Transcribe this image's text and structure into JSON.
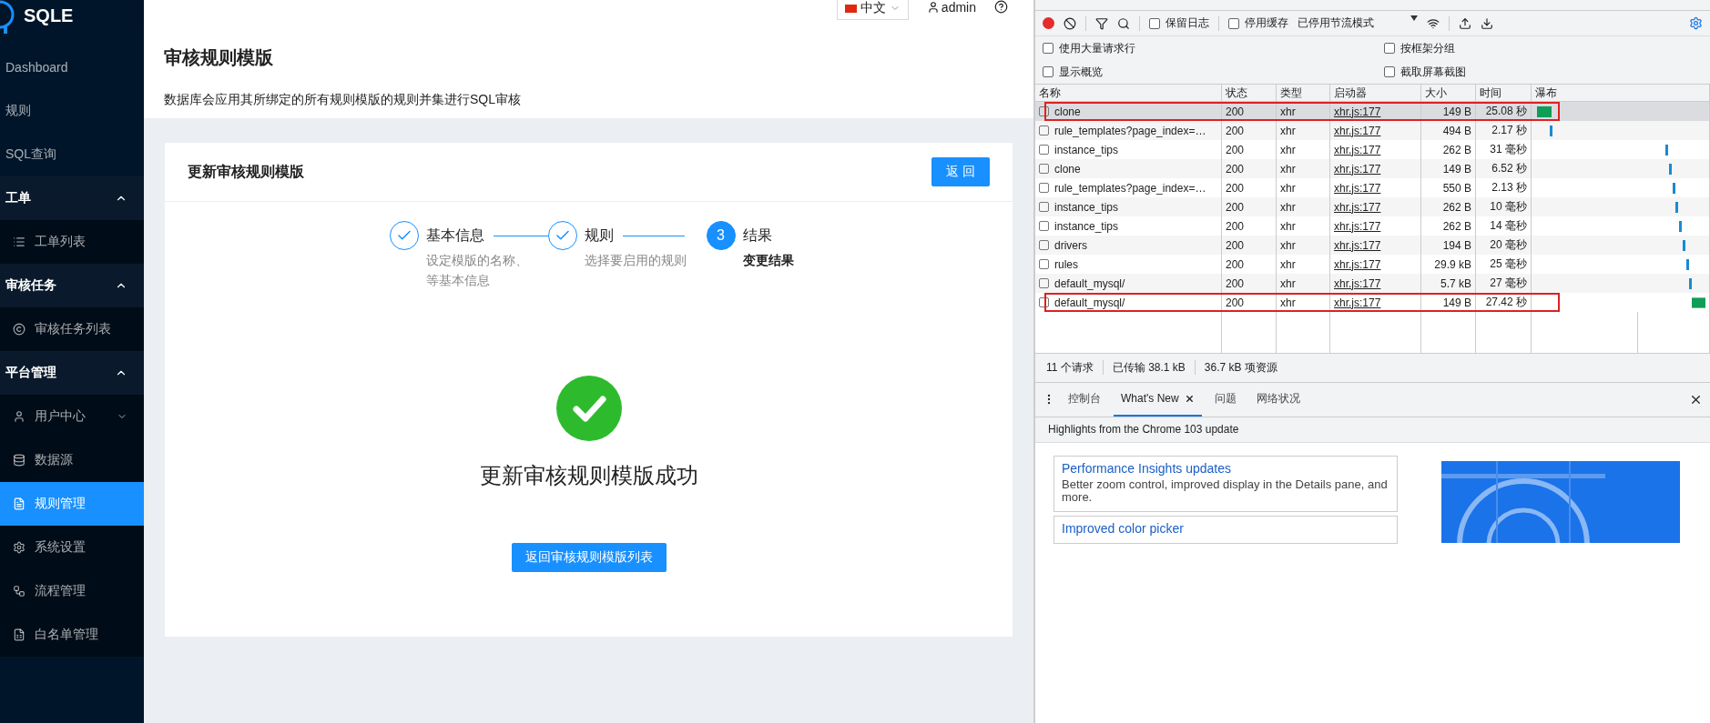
{
  "sidebar": {
    "logo": "SQLE",
    "items": [
      {
        "kind": "link",
        "label": "Dashboard",
        "selected": false
      },
      {
        "kind": "link",
        "label": "规则",
        "selected": false
      },
      {
        "kind": "link",
        "label": "SQL查询",
        "selected": false
      },
      {
        "kind": "group",
        "label": "工单",
        "expanded": true,
        "children": [
          {
            "kind": "link",
            "label": "工单列表",
            "selected": false
          }
        ]
      },
      {
        "kind": "group",
        "label": "审核任务",
        "expanded": true,
        "children": [
          {
            "kind": "link",
            "label": "审核任务列表",
            "selected": false
          }
        ]
      },
      {
        "kind": "group",
        "label": "平台管理",
        "expanded": true,
        "children": [
          {
            "kind": "submenu",
            "label": "用户中心",
            "expanded": false,
            "selected": false
          },
          {
            "kind": "link",
            "label": "数据源",
            "selected": false
          },
          {
            "kind": "link",
            "label": "规则管理",
            "selected": true
          },
          {
            "kind": "link",
            "label": "系统设置",
            "selected": false
          },
          {
            "kind": "link",
            "label": "流程管理",
            "selected": false
          },
          {
            "kind": "link",
            "label": "白名单管理",
            "selected": false
          }
        ]
      }
    ]
  },
  "topbar": {
    "language": "中文",
    "user": "admin"
  },
  "page": {
    "title": "审核规则模版",
    "description": "数据库会应用其所绑定的所有规则模版的规则并集进行SQL审核"
  },
  "card": {
    "title": "更新审核规则模版",
    "back_button": "返 回",
    "steps": [
      {
        "title": "基本信息",
        "description_lines": [
          "设定模版的名称、",
          "等基本信息"
        ],
        "finished": true
      },
      {
        "title": "规则",
        "description_lines": [
          "选择要启用的规则"
        ],
        "finished": true
      },
      {
        "title": "结果",
        "number": "3",
        "description_lines": [
          "变更结果"
        ],
        "finished": false
      }
    ],
    "result": {
      "success": true,
      "title": "更新审核规则模版成功",
      "button": "返回审核规则模版列表"
    }
  },
  "devtools": {
    "toolbar": {
      "recording": true,
      "checkboxes": [
        {
          "label": "保留日志",
          "checked": false
        },
        {
          "label": "停用缓存",
          "checked": false
        }
      ],
      "throttle": "已停用节流模式"
    },
    "options": [
      {
        "label": "使用大量请求行",
        "checked": false
      },
      {
        "label": "按框架分组",
        "checked": false
      },
      {
        "label": "显示概览",
        "checked": false
      },
      {
        "label": "截取屏幕截图",
        "checked": false
      }
    ],
    "network_table": {
      "columns": [
        "名称",
        "状态",
        "类型",
        "启动器",
        "大小",
        "时间",
        "瀑布"
      ],
      "rows": [
        {
          "name": "clone",
          "status": "200",
          "type": "xhr",
          "initiator": "xhr.js:177",
          "size": "149 B",
          "time": "25.08 秒",
          "selected": true,
          "highlighted": true
        },
        {
          "name": "rule_templates?page_index=…",
          "status": "200",
          "type": "xhr",
          "initiator": "xhr.js:177",
          "size": "494 B",
          "time": "2.17 秒",
          "selected": false,
          "highlighted": false
        },
        {
          "name": "instance_tips",
          "status": "200",
          "type": "xhr",
          "initiator": "xhr.js:177",
          "size": "262 B",
          "time": "31 毫秒",
          "selected": false,
          "highlighted": false
        },
        {
          "name": "clone",
          "status": "200",
          "type": "xhr",
          "initiator": "xhr.js:177",
          "size": "149 B",
          "time": "6.52 秒",
          "selected": false,
          "highlighted": false
        },
        {
          "name": "rule_templates?page_index=…",
          "status": "200",
          "type": "xhr",
          "initiator": "xhr.js:177",
          "size": "550 B",
          "time": "2.13 秒",
          "selected": false,
          "highlighted": false
        },
        {
          "name": "instance_tips",
          "status": "200",
          "type": "xhr",
          "initiator": "xhr.js:177",
          "size": "262 B",
          "time": "10 毫秒",
          "selected": false,
          "highlighted": false
        },
        {
          "name": "instance_tips",
          "status": "200",
          "type": "xhr",
          "initiator": "xhr.js:177",
          "size": "262 B",
          "time": "14 毫秒",
          "selected": false,
          "highlighted": false
        },
        {
          "name": "drivers",
          "status": "200",
          "type": "xhr",
          "initiator": "xhr.js:177",
          "size": "194 B",
          "time": "20 毫秒",
          "selected": false,
          "highlighted": false
        },
        {
          "name": "rules",
          "status": "200",
          "type": "xhr",
          "initiator": "xhr.js:177",
          "size": "29.9 kB",
          "time": "25 毫秒",
          "selected": false,
          "highlighted": false
        },
        {
          "name": "default_mysql/",
          "status": "200",
          "type": "xhr",
          "initiator": "xhr.js:177",
          "size": "5.7 kB",
          "time": "27 毫秒",
          "selected": false,
          "highlighted": false
        },
        {
          "name": "default_mysql/",
          "status": "200",
          "type": "xhr",
          "initiator": "xhr.js:177",
          "size": "149 B",
          "time": "27.42 秒",
          "selected": false,
          "highlighted": true
        }
      ]
    },
    "status_bar": [
      "11 个请求",
      "已传输 38.1 kB",
      "36.7 kB 项资源"
    ],
    "drawer": {
      "tabs": [
        {
          "label": "控制台",
          "selected": false,
          "closable": false
        },
        {
          "label": "What's New",
          "selected": true,
          "closable": true
        },
        {
          "label": "问题",
          "selected": false,
          "closable": false
        },
        {
          "label": "网络状况",
          "selected": false,
          "closable": false
        }
      ],
      "banner": "Highlights from the Chrome 103 update",
      "cards": [
        {
          "title": "Performance Insights updates",
          "description": "Better zoom control, improved display in the Details pane, and more."
        },
        {
          "title": "Improved color picker"
        }
      ]
    }
  }
}
